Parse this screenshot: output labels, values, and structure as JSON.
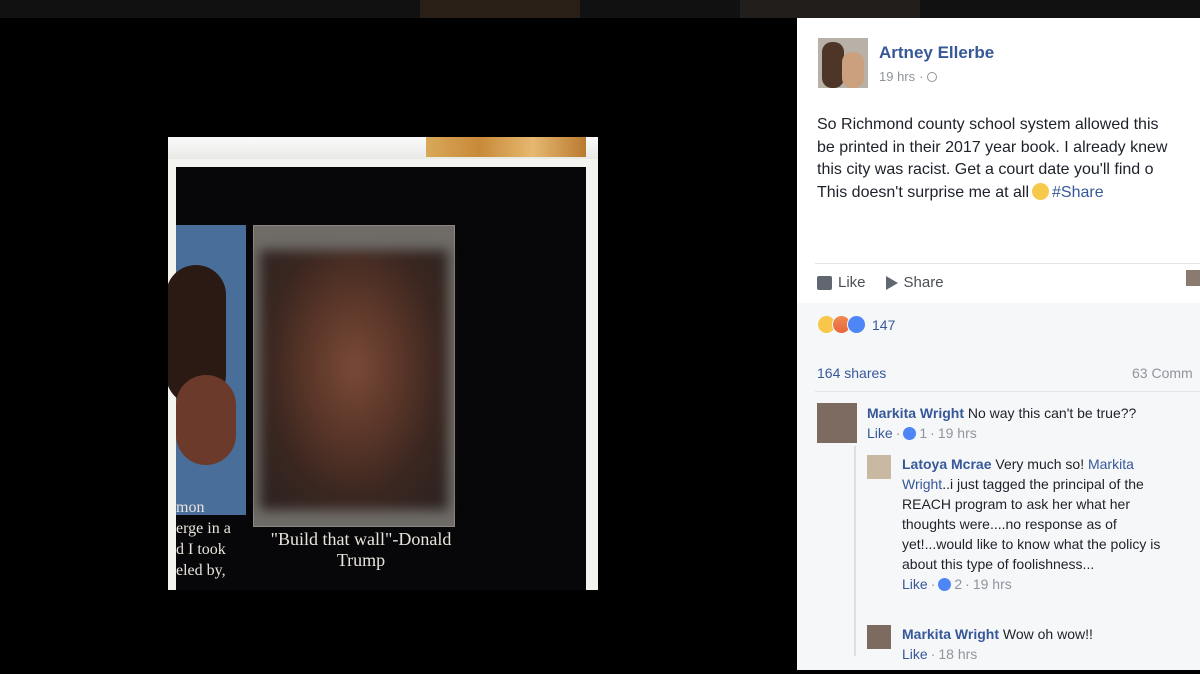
{
  "post": {
    "author": "Artney Ellerbe",
    "time": "19 hrs",
    "time_separator": "·",
    "text_lines": [
      "So Richmond county school system allowed this",
      "be printed in their 2017 year book. I already knew",
      "this city was racist. Get a court date you'll find o",
      "This doesn't surprise me at all"
    ],
    "hashtag": "#Share",
    "photo": {
      "caption_lines": [
        "\"Build that wall\"-Donald",
        "Trump"
      ],
      "left_text": [
        "mon",
        "erge in a",
        "d I took",
        "eled by,"
      ]
    }
  },
  "actions": {
    "like": "Like",
    "share": "Share"
  },
  "reactions": {
    "count": "147"
  },
  "stats": {
    "shares": "164 shares",
    "comments": "63 Comm"
  },
  "comments": [
    {
      "name": "Markita Wright",
      "text": "No way this can't be true??",
      "like": "Like",
      "likes": "1",
      "time": "19 hrs"
    },
    {
      "name": "Latoya Mcrae",
      "text_lines": [
        "Very much so! ",
        "..i just tagged the principal of the",
        "REACH program to ask her what her",
        "thoughts were....no response as of",
        "yet!...would like to know what the policy is",
        "about this type of foolishness..."
      ],
      "mention_a": "Markita",
      "mention_b": "Wright",
      "like": "Like",
      "likes": "2",
      "time": "19 hrs"
    },
    {
      "name": "Markita Wright",
      "text": "Wow oh wow!!",
      "like": "Like",
      "time": "18 hrs"
    }
  ],
  "colors": {
    "link": "#365899",
    "meta": "#90949c",
    "panel_bg": "#ffffff",
    "stats_bg": "#f6f7f9"
  }
}
